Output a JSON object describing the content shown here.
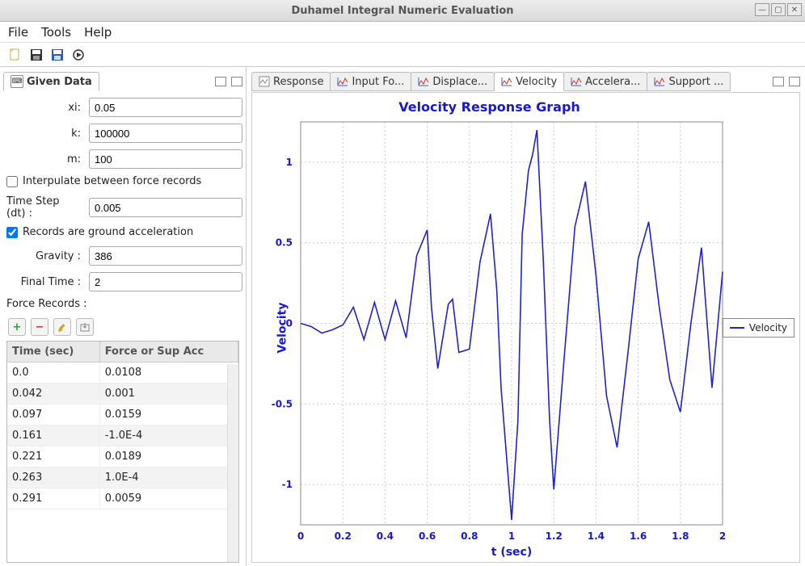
{
  "window": {
    "title": "Duhamel Integral Numeric Evaluation"
  },
  "menu": {
    "file": "File",
    "tools": "Tools",
    "help": "Help"
  },
  "panel": {
    "title": "Given Data"
  },
  "fields": {
    "xi_label": "xi:",
    "xi": "0.05",
    "k_label": "k:",
    "k": "100000",
    "m_label": "m:",
    "m": "100",
    "interp_label": "Interpulate between force records",
    "dt_label": "Time Step (dt) :",
    "dt": "0.005",
    "ground_label": "Records are ground acceleration",
    "gravity_label": "Gravity :",
    "gravity": "386",
    "final_time_label": "Final Time :",
    "final_time": "2",
    "force_records_label": "Force Records :"
  },
  "table": {
    "col1": "Time (sec)",
    "col2": "Force or Sup Acc",
    "rows": [
      {
        "t": "0.0",
        "f": "0.0108"
      },
      {
        "t": "0.042",
        "f": "0.001"
      },
      {
        "t": "0.097",
        "f": "0.0159"
      },
      {
        "t": "0.161",
        "f": "-1.0E-4"
      },
      {
        "t": "0.221",
        "f": "0.0189"
      },
      {
        "t": "0.263",
        "f": "1.0E-4"
      },
      {
        "t": "0.291",
        "f": "0.0059"
      }
    ]
  },
  "tabs": {
    "response": "Response",
    "input": "Input Fo...",
    "displace": "Displace...",
    "velocity": "Velocity",
    "accel": "Accelera...",
    "support": "Support ..."
  },
  "chart_data": {
    "type": "line",
    "title": "Velocity Response Graph",
    "xlabel": "t (sec)",
    "ylabel": "Velocity",
    "legend": "Velocity",
    "xlim": [
      0,
      2
    ],
    "ylim": [
      -1.25,
      1.25
    ],
    "xticks": [
      0,
      0.2,
      0.4,
      0.6,
      0.8,
      1,
      1.2,
      1.4,
      1.6,
      1.8,
      2
    ],
    "yticks": [
      -1,
      -0.5,
      0,
      0.5,
      1
    ],
    "series": [
      {
        "name": "Velocity",
        "color": "#2222cc",
        "x": [
          0,
          0.05,
          0.1,
          0.15,
          0.2,
          0.25,
          0.3,
          0.35,
          0.4,
          0.45,
          0.5,
          0.55,
          0.6,
          0.62,
          0.65,
          0.7,
          0.72,
          0.75,
          0.8,
          0.85,
          0.9,
          0.93,
          0.95,
          1.0,
          1.03,
          1.05,
          1.08,
          1.1,
          1.12,
          1.15,
          1.18,
          1.2,
          1.25,
          1.3,
          1.35,
          1.4,
          1.45,
          1.5,
          1.55,
          1.6,
          1.65,
          1.7,
          1.75,
          1.8,
          1.85,
          1.9,
          1.95,
          2.0
        ],
        "y": [
          0,
          -0.02,
          -0.06,
          -0.04,
          -0.01,
          0.1,
          -0.1,
          0.13,
          -0.1,
          0.14,
          -0.09,
          0.42,
          0.58,
          0.1,
          -0.28,
          0.12,
          0.15,
          -0.18,
          -0.16,
          0.38,
          0.68,
          0.2,
          -0.4,
          -1.22,
          -0.6,
          0.55,
          0.95,
          1.05,
          1.2,
          0.4,
          -0.6,
          -1.03,
          -0.2,
          0.6,
          0.88,
          0.3,
          -0.45,
          -0.77,
          -0.2,
          0.4,
          0.63,
          0.1,
          -0.35,
          -0.55,
          0.0,
          0.47,
          -0.4,
          0.32
        ]
      }
    ]
  }
}
